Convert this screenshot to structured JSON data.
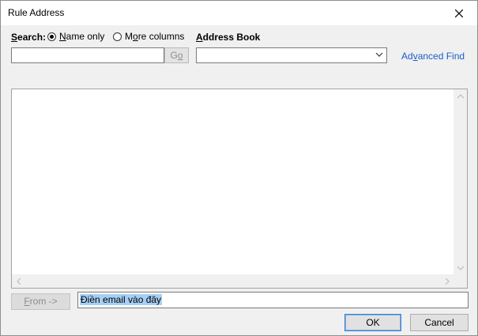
{
  "window": {
    "title": "Rule Address"
  },
  "search": {
    "label": "Search:",
    "option_name_only": "Name only",
    "option_more_columns": "More columns",
    "selected": "Name only",
    "input_value": "",
    "go_label": "Go"
  },
  "address_book": {
    "label": "Address Book",
    "selected_value": ""
  },
  "advanced_find_label": "Advanced Find",
  "results_list": {
    "items": []
  },
  "from": {
    "button_label": "From ->",
    "input_value": "Điền email vào đây"
  },
  "footer": {
    "ok_label": "OK",
    "cancel_label": "Cancel"
  },
  "icons": {
    "close": "close-icon",
    "dropdown": "chevron-down-icon",
    "scroll_up": "scroll-up-icon",
    "scroll_down": "scroll-down-icon",
    "scroll_left": "scroll-left-icon",
    "scroll_right": "scroll-right-icon"
  },
  "colors": {
    "link": "#1a5ec9",
    "selection": "#a6cff5",
    "default_button_border": "#3c7fd1"
  }
}
